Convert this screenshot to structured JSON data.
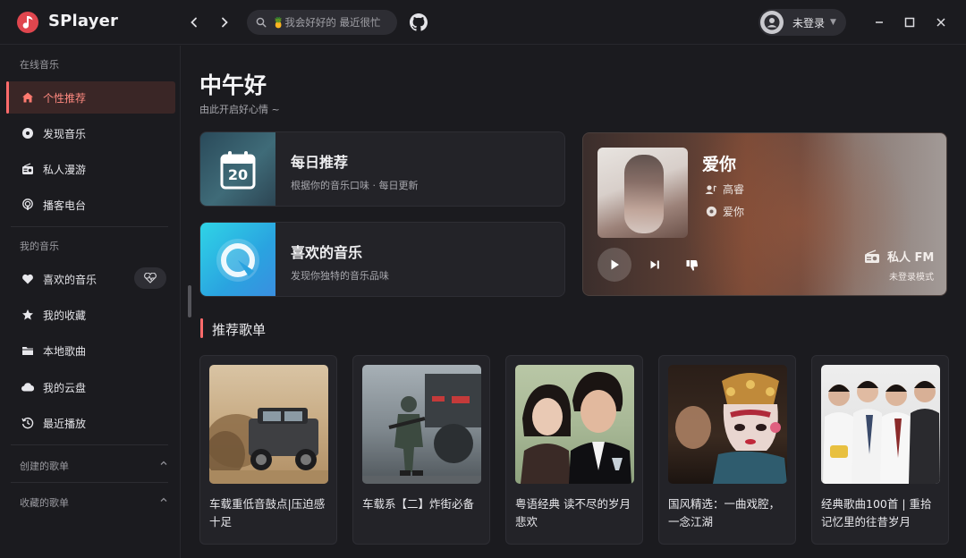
{
  "app": {
    "name": "SPlayer"
  },
  "search": {
    "placeholder": "🍍我会好好的 最近很忙"
  },
  "user": {
    "name": "未登录"
  },
  "sidebar": {
    "online_title": "在线音乐",
    "online": [
      {
        "label": "个性推荐",
        "icon": "home-icon",
        "active": true
      },
      {
        "label": "发现音乐",
        "icon": "disc-icon"
      },
      {
        "label": "私人漫游",
        "icon": "radio-icon"
      },
      {
        "label": "播客电台",
        "icon": "podcast-icon"
      }
    ],
    "mine_title": "我的音乐",
    "mine": [
      {
        "label": "喜欢的音乐",
        "icon": "heart-icon"
      },
      {
        "label": "我的收藏",
        "icon": "star-icon"
      },
      {
        "label": "本地歌曲",
        "icon": "folder-icon"
      },
      {
        "label": "我的云盘",
        "icon": "cloud-icon"
      },
      {
        "label": "最近播放",
        "icon": "history-icon"
      }
    ],
    "created_title": "创建的歌单",
    "collected_title": "收藏的歌单"
  },
  "main": {
    "greeting": "中午好",
    "subtitle": "由此开启好心情 ~",
    "daily": {
      "title": "每日推荐",
      "desc": "根据你的音乐口味 · 每日更新",
      "day": "20"
    },
    "liked": {
      "title": "喜欢的音乐",
      "desc": "发现你独特的音乐品味"
    },
    "fm": {
      "song": "爱你",
      "artist": "高睿",
      "album": "爱你",
      "label": "私人 FM",
      "mode": "未登录模式"
    },
    "section_title": "推荐歌单",
    "playlists": [
      {
        "name": "车载重低音鼓点|压迫感十足"
      },
      {
        "name": "车载系【二】炸街必备"
      },
      {
        "name": "粤语经典 读不尽的岁月悲欢"
      },
      {
        "name": "国风精选：一曲戏腔，一念江湖"
      },
      {
        "name": "经典歌曲100首 | 重拾记忆里的往昔岁月"
      }
    ]
  },
  "colors": {
    "accent": "#ff6b6b",
    "background": "#1b1b1f",
    "card": "#232328"
  }
}
